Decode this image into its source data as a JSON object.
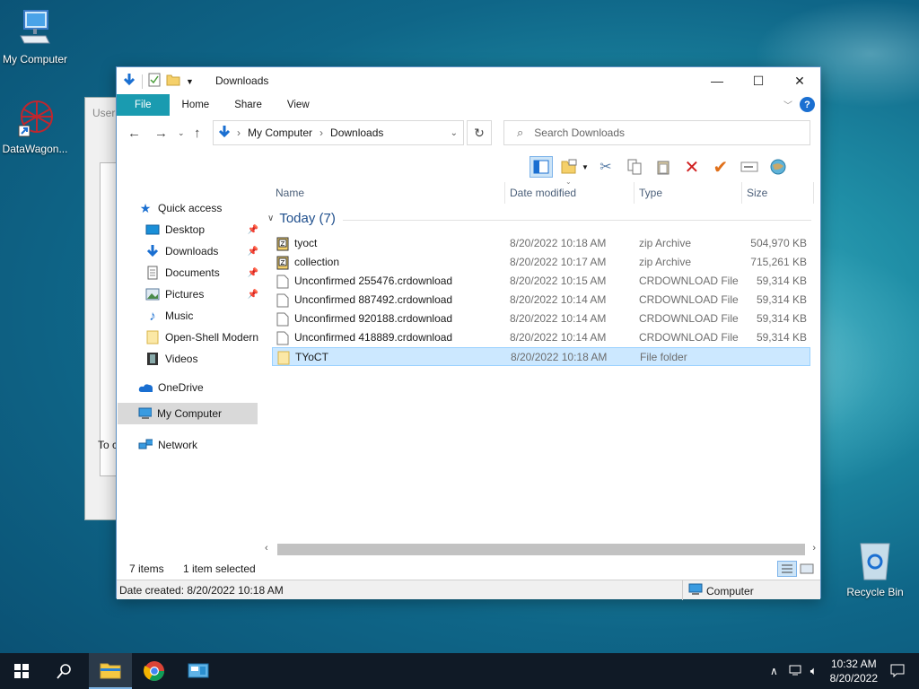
{
  "desktop": {
    "icons": [
      {
        "label": "My Computer"
      },
      {
        "label": "DataWagon..."
      },
      {
        "label": "Recycle Bin"
      }
    ],
    "bg_dialog": {
      "title": "User",
      "text": "To c"
    }
  },
  "window": {
    "title": "Downloads",
    "ribbon_tabs": [
      "File",
      "Home",
      "Share",
      "View"
    ],
    "address": {
      "segments": [
        "My Computer",
        "Downloads"
      ]
    },
    "search": {
      "placeholder": "Search Downloads"
    },
    "nav": {
      "quick_access": "Quick access",
      "items": [
        {
          "label": "Desktop",
          "pinned": true,
          "icon": "desktop-icon"
        },
        {
          "label": "Downloads",
          "pinned": true,
          "icon": "downloads-icon"
        },
        {
          "label": "Documents",
          "pinned": true,
          "icon": "documents-icon"
        },
        {
          "label": "Pictures",
          "pinned": true,
          "icon": "pictures-icon"
        },
        {
          "label": "Music",
          "pinned": false,
          "icon": "music-icon"
        },
        {
          "label": "Open-Shell Modern",
          "pinned": false,
          "icon": "folder-icon"
        },
        {
          "label": "Videos",
          "pinned": false,
          "icon": "videos-icon"
        }
      ],
      "onedrive": "OneDrive",
      "my_computer": "My Computer",
      "network": "Network"
    },
    "columns": {
      "name": "Name",
      "date": "Date modified",
      "type": "Type",
      "size": "Size"
    },
    "group": {
      "label": "Today (7)"
    },
    "files": [
      {
        "name": "tyoct",
        "date": "8/20/2022 10:18 AM",
        "type": "zip Archive",
        "size": "504,970 KB",
        "kind": "zip"
      },
      {
        "name": "collection",
        "date": "8/20/2022 10:17 AM",
        "type": "zip Archive",
        "size": "715,261 KB",
        "kind": "zip"
      },
      {
        "name": "Unconfirmed 255476.crdownload",
        "date": "8/20/2022 10:15 AM",
        "type": "CRDOWNLOAD File",
        "size": "59,314 KB",
        "kind": "file"
      },
      {
        "name": "Unconfirmed 887492.crdownload",
        "date": "8/20/2022 10:14 AM",
        "type": "CRDOWNLOAD File",
        "size": "59,314 KB",
        "kind": "file"
      },
      {
        "name": "Unconfirmed 920188.crdownload",
        "date": "8/20/2022 10:14 AM",
        "type": "CRDOWNLOAD File",
        "size": "59,314 KB",
        "kind": "file"
      },
      {
        "name": "Unconfirmed 418889.crdownload",
        "date": "8/20/2022 10:14 AM",
        "type": "CRDOWNLOAD File",
        "size": "59,314 KB",
        "kind": "file"
      },
      {
        "name": "TYoCT",
        "date": "8/20/2022 10:18 AM",
        "type": "File folder",
        "size": "",
        "kind": "folder",
        "selected": true
      }
    ],
    "status": {
      "items": "7 items",
      "selected": "1 item selected"
    },
    "details": {
      "created": "Date created: 8/20/2022 10:18 AM",
      "location": "Computer"
    }
  },
  "taskbar": {
    "time": "10:32 AM",
    "date": "8/20/2022"
  },
  "colors": {
    "file_tab": "#1a9bb0",
    "selection": "#cce8ff",
    "accent": "#1e4e8c"
  }
}
